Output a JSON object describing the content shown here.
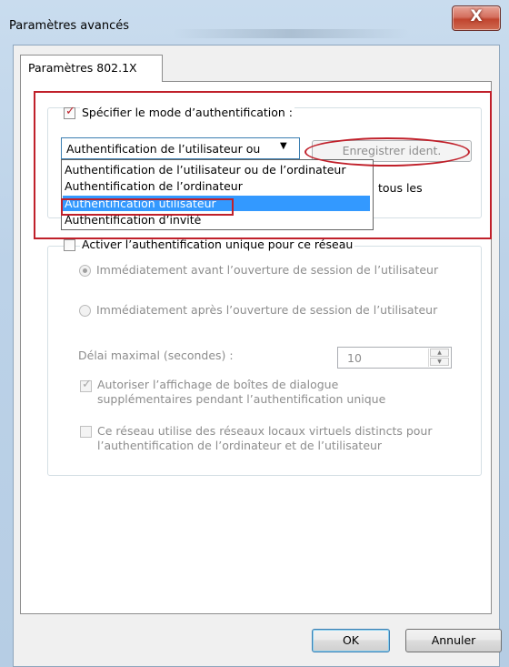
{
  "window": {
    "title": "Paramètres avancés",
    "close_glyph": "X",
    "close_icon": "close-icon"
  },
  "tab": {
    "label": "Paramètres 802.1X"
  },
  "auth_mode": {
    "checkbox_label": "Spécifier le mode d’authentification :",
    "checked": true,
    "selected_value": "Authentification de l’utilisateur ou",
    "arrow_glyph": "▼",
    "save_credentials_label": "Enregistrer ident.",
    "options": [
      "Authentification de l’utilisateur ou de l’ordinateur",
      "Authentification de l’ordinateur",
      "Authentification utilisateur",
      "Authentification d’invité"
    ],
    "highlighted_option_index": 2,
    "partially_hidden_text": "tous les"
  },
  "sso": {
    "checkbox_label": "Activer l’authentification unique pour ce réseau",
    "radio_before_label": "Immédiatement avant l’ouverture de session de l’utilisateur",
    "radio_after_label": "Immédiatement après l’ouverture de session de l’utilisateur",
    "delay_label": "Délai maximal (secondes) :",
    "delay_value": "10",
    "spin_up_glyph": "▲",
    "spin_down_glyph": "▼",
    "allow_dialogs_line1": "Autoriser l’affichage de boîtes de dialogue",
    "allow_dialogs_line2": "supplémentaires pendant l’authentification unique",
    "vlan_line1": "Ce réseau utilise des réseaux locaux virtuels distincts pour",
    "vlan_line2": "l’authentification de l’ordinateur et de l’utilisateur"
  },
  "buttons": {
    "ok": "OK",
    "cancel": "Annuler"
  },
  "colors": {
    "annotation": "#c0202a",
    "selection": "#3399ff",
    "checkmark": "#c0202a"
  }
}
